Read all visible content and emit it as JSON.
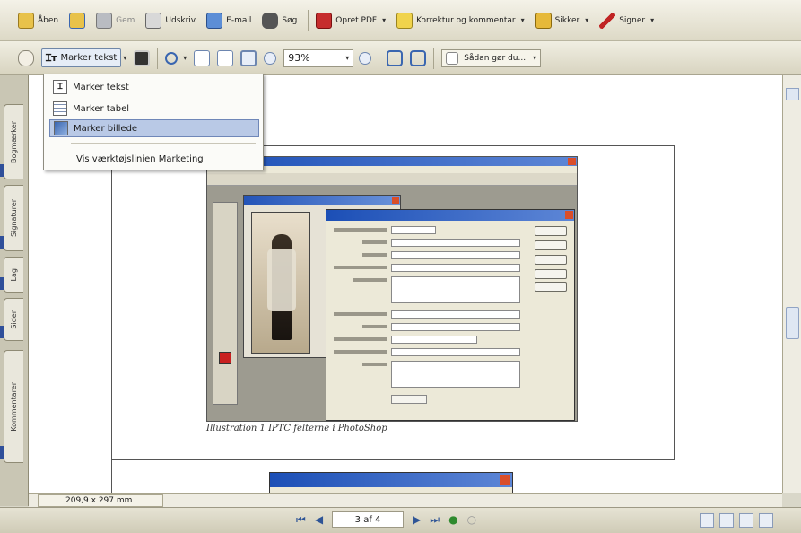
{
  "toolbar": {
    "items": [
      {
        "label": "Åben",
        "icon": "open-folder-icon"
      },
      {
        "label": "",
        "icon": "open-web-icon"
      },
      {
        "label": "Gem",
        "icon": "save-icon"
      },
      {
        "label": "Udskriv",
        "icon": "print-icon"
      },
      {
        "label": "E-mail",
        "icon": "email-icon"
      },
      {
        "label": "Søg",
        "icon": "binoculars-icon"
      },
      {
        "label": "Opret PDF",
        "icon": "create-pdf-icon"
      },
      {
        "label": "Korrektur og kommentar",
        "icon": "review-comment-icon"
      },
      {
        "label": "Sikker",
        "icon": "lock-icon"
      },
      {
        "label": "Signer",
        "icon": "pen-sign-icon"
      }
    ]
  },
  "toolbar2": {
    "select_tool_label": "Marker tekst",
    "zoom_value": "93%",
    "read_mode_label": "Sådan gør du..."
  },
  "select_menu": {
    "items": [
      {
        "label": "Marker tekst",
        "selected": false
      },
      {
        "label": "Marker tabel",
        "selected": false
      },
      {
        "label": "Marker billede",
        "selected": true
      }
    ],
    "extra": "Vis værktøjslinien Marketing"
  },
  "side_tabs": [
    "Bogmærker",
    "Signaturer",
    "Lag",
    "Sider",
    "Kommentarer"
  ],
  "document": {
    "caption": "Illustration 1 IPTC felterne i PhotoShop"
  },
  "status": {
    "page_size": "209,9 x 297 mm",
    "page_indicator": "3 af 4"
  },
  "colors": {
    "title_blue": "#1c4fb6",
    "close_red": "#d94e2a",
    "accent_blue": "#2f4f9a"
  }
}
